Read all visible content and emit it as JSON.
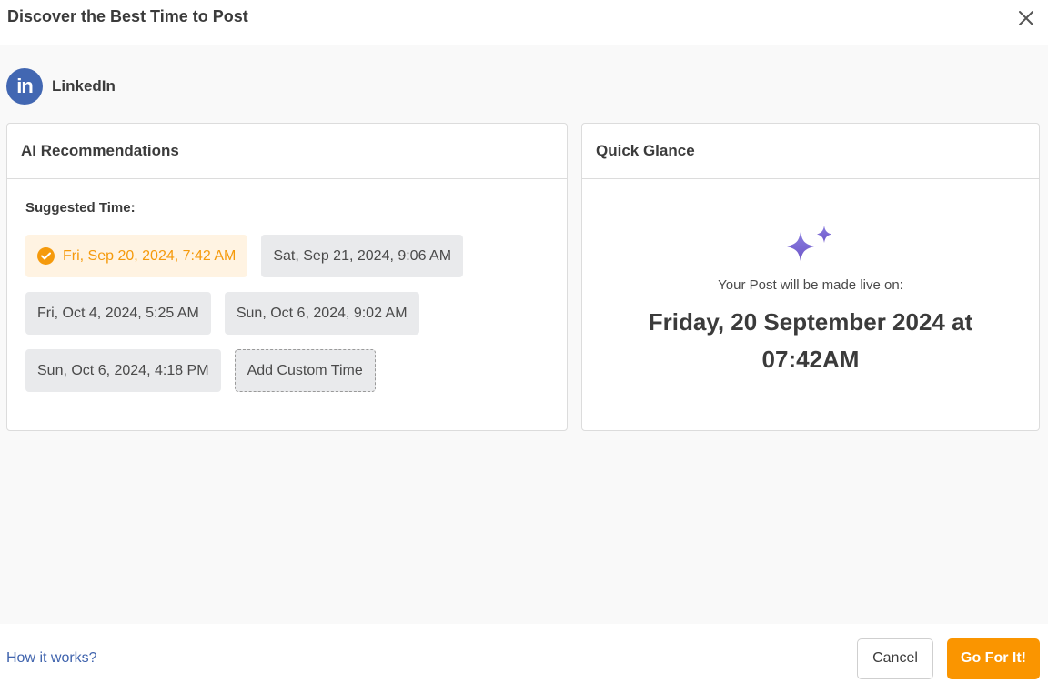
{
  "header": {
    "title": "Discover the Best Time to Post",
    "close_icon": "close-icon"
  },
  "platform": {
    "icon": "linkedin-icon",
    "icon_text": "in",
    "name": "LinkedIn",
    "brand_color": "#4267b2"
  },
  "ai_card": {
    "title": "AI Recommendations",
    "suggested_label": "Suggested Time:",
    "times": [
      {
        "label": "Fri, Sep 20, 2024, 7:42 AM",
        "selected": true
      },
      {
        "label": "Sat, Sep 21, 2024, 9:06 AM",
        "selected": false
      },
      {
        "label": "Fri, Oct 4, 2024, 5:25 AM",
        "selected": false
      },
      {
        "label": "Sun, Oct 6, 2024, 9:02 AM",
        "selected": false
      },
      {
        "label": "Sun, Oct 6, 2024, 4:18 PM",
        "selected": false
      }
    ],
    "custom_label": "Add Custom Time",
    "selected_color": "#f59a0c"
  },
  "glance_card": {
    "title": "Quick Glance",
    "icon": "sparkles-icon",
    "text": "Your Post will be made live on:",
    "date_line1": "Friday, 20 September 2024 at",
    "date_line2": "07:42AM",
    "accent_color": "#7b68d6"
  },
  "footer": {
    "how_link": "How it works?",
    "cancel_label": "Cancel",
    "go_label": "Go For It!",
    "go_color": "#fa9500"
  }
}
